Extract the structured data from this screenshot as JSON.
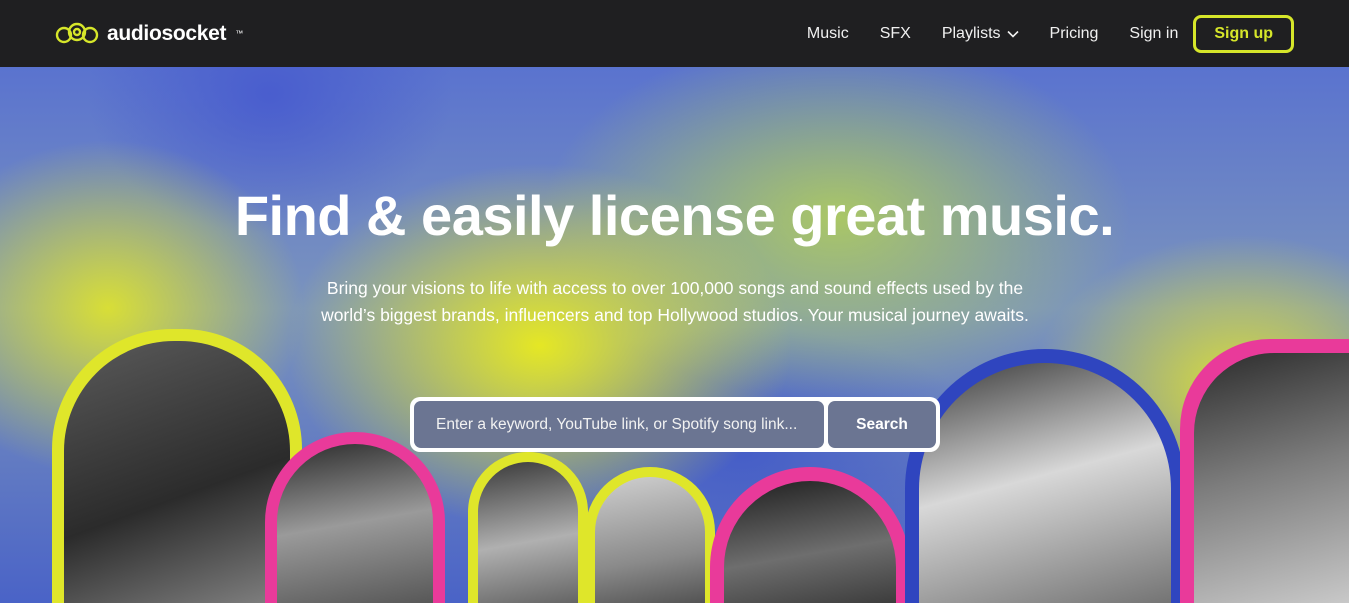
{
  "brand": {
    "name": "audiosocket",
    "tm": "™",
    "accent": "#d6e62a"
  },
  "nav": {
    "links": [
      {
        "label": "Music"
      },
      {
        "label": "SFX"
      },
      {
        "label": "Playlists",
        "dropdown": true,
        "icon": "chevron-down-icon"
      },
      {
        "label": "Pricing"
      },
      {
        "label": "Sign in"
      }
    ],
    "signup_label": "Sign up"
  },
  "hero": {
    "headline": "Find & easily license great music.",
    "subtitle": "Bring your visions to life with access to over 100,000 songs and sound effects used by the world’s biggest brands, influencers and top Hollywood studios. Your musical journey awaits.",
    "search": {
      "placeholder": "Enter a keyword, YouTube link, or Spotify song link...",
      "value": "",
      "button_label": "Search"
    },
    "outline_colors": {
      "yellow": "#dfe62a",
      "pink": "#e93a9a",
      "blue": "#2f45bf"
    }
  }
}
